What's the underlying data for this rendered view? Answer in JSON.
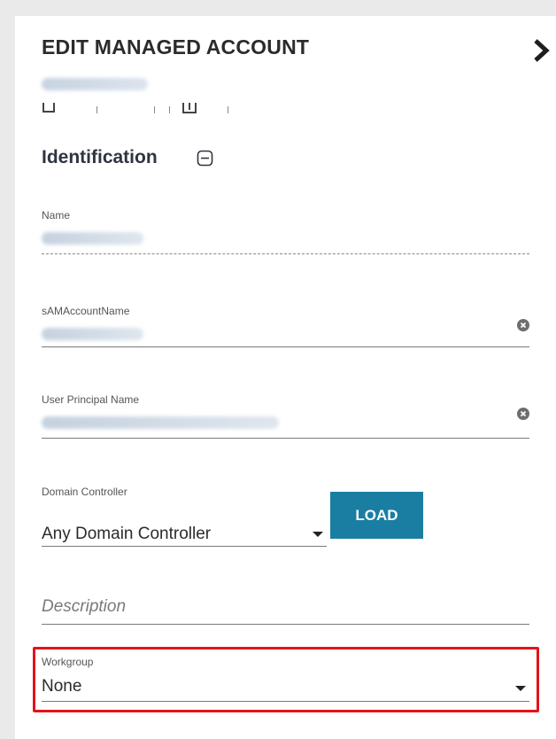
{
  "header": {
    "title": "EDIT MANAGED ACCOUNT",
    "chevron_icon": "chevron-right-icon"
  },
  "section": {
    "title": "Identification",
    "collapse_icon": "collapse-minus-icon"
  },
  "fields": {
    "name_label": "Name",
    "sam_label": "sAMAccountName",
    "upn_label": "User Principal Name",
    "clear_icon": "clear-icon"
  },
  "domain_controller": {
    "label": "Domain Controller",
    "value": "Any Domain Controller",
    "load_label": "LOAD"
  },
  "description": {
    "placeholder": "Description",
    "value": ""
  },
  "workgroup": {
    "label": "Workgroup",
    "value": "None"
  },
  "colors": {
    "accent": "#1a7ea3",
    "highlight": "#e2141b"
  }
}
